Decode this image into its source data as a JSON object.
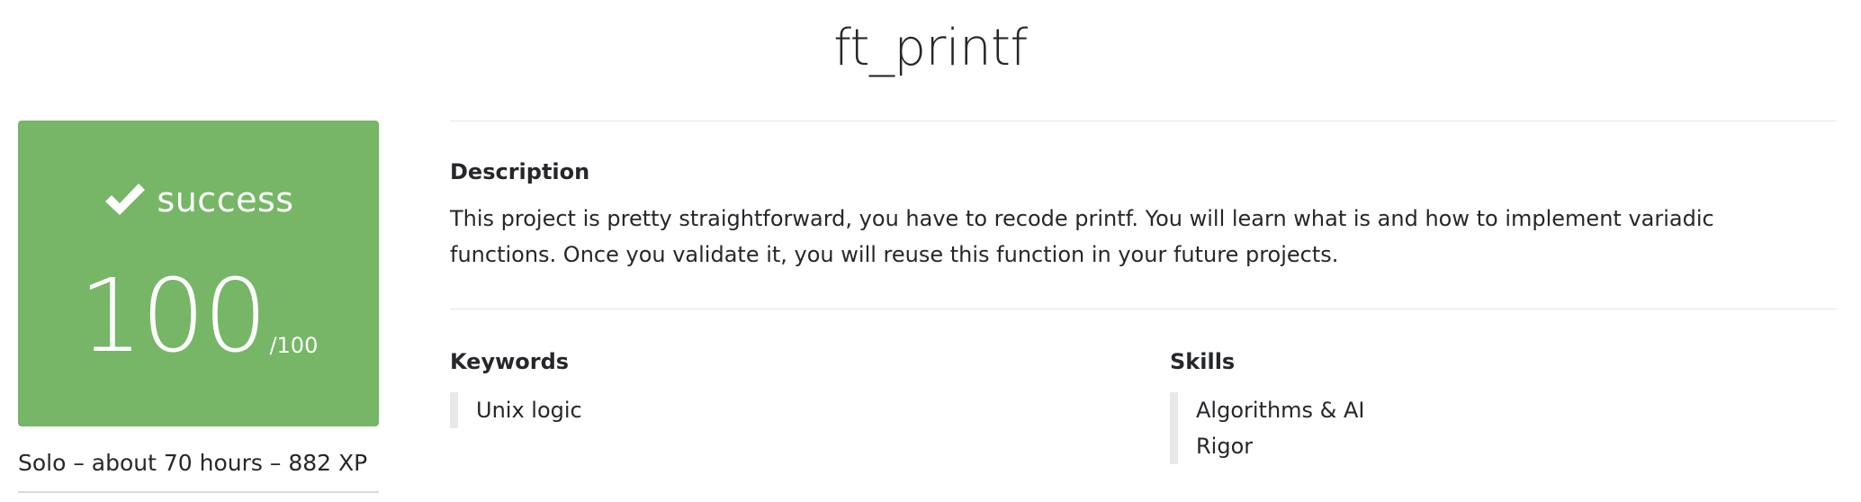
{
  "page": {
    "title": "ft_printf"
  },
  "score_card": {
    "status": "success",
    "score": "100",
    "max": "/100",
    "color": "#76b666",
    "icon": "check-icon"
  },
  "meta": {
    "summary": "Solo – about 70 hours – 882 XP"
  },
  "description": {
    "heading": "Description",
    "text": "This project is pretty straightforward, you have to recode printf. You will learn what is and how to implement variadic functions. Once you validate it, you will reuse this function in your future projects."
  },
  "keywords": {
    "heading": "Keywords",
    "items": [
      "Unix logic"
    ]
  },
  "skills": {
    "heading": "Skills",
    "items": [
      "Algorithms & AI",
      "Rigor"
    ]
  }
}
